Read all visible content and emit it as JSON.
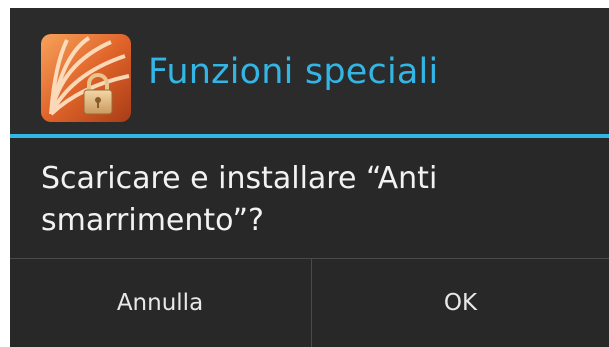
{
  "dialog": {
    "title": "Funzioni speciali",
    "icon": "orange-shell-lock-icon",
    "message": "Scaricare e installare “Anti smarrimento”?",
    "buttons": {
      "cancel_label": "Annulla",
      "ok_label": "OK"
    }
  },
  "colors": {
    "accent": "#33b5e5",
    "background": "#282828",
    "text": "#f2f2f2"
  }
}
